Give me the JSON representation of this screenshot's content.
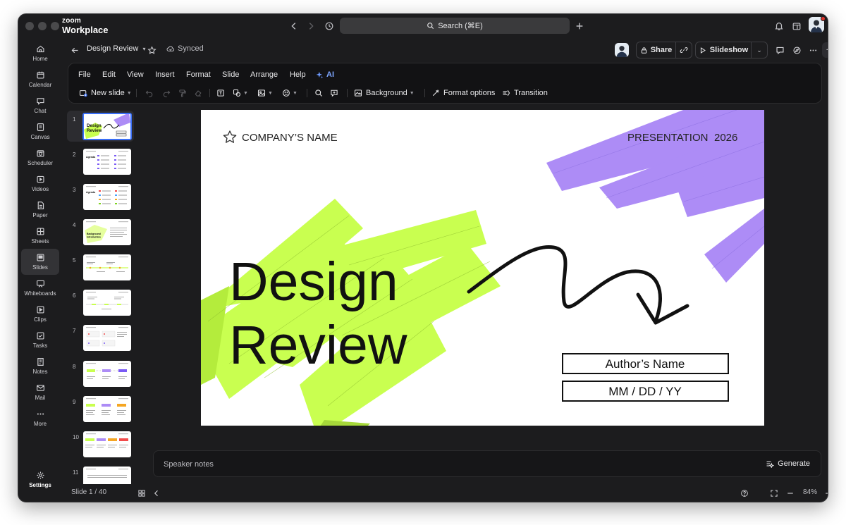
{
  "app": {
    "logo_line1": "zoom",
    "logo_line2": "Workplace",
    "search_placeholder": "Search (⌘E)"
  },
  "sidebar": {
    "items": [
      {
        "label": "Home",
        "icon": "home-icon"
      },
      {
        "label": "Calendar",
        "icon": "calendar-icon"
      },
      {
        "label": "Chat",
        "icon": "chat-icon"
      },
      {
        "label": "Canvas",
        "icon": "canvas-icon"
      },
      {
        "label": "Scheduler",
        "icon": "scheduler-icon"
      },
      {
        "label": "Videos",
        "icon": "videos-icon"
      },
      {
        "label": "Paper",
        "icon": "paper-icon"
      },
      {
        "label": "Sheets",
        "icon": "sheets-icon"
      },
      {
        "label": "Slides",
        "icon": "slides-icon",
        "active": true
      },
      {
        "label": "Whiteboards",
        "icon": "whiteboard-icon"
      },
      {
        "label": "Clips",
        "icon": "clips-icon"
      },
      {
        "label": "Tasks",
        "icon": "tasks-icon"
      },
      {
        "label": "Notes",
        "icon": "notes-icon"
      },
      {
        "label": "Mail",
        "icon": "mail-icon"
      },
      {
        "label": "More",
        "icon": "more-icon"
      }
    ],
    "settings_label": "Settings"
  },
  "header": {
    "doc_title": "Design Review",
    "sync_status": "Synced",
    "share_label": "Share",
    "slideshow_label": "Slideshow"
  },
  "menu": {
    "items": [
      "File",
      "Edit",
      "View",
      "Insert",
      "Format",
      "Slide",
      "Arrange",
      "Help"
    ],
    "ai_label": "AI"
  },
  "toolbar": {
    "new_slide_label": "New slide",
    "background_label": "Background",
    "format_options_label": "Format options",
    "transition_label": "Transition"
  },
  "thumbnails": {
    "numbers": [
      "1",
      "2",
      "3",
      "4",
      "5",
      "6",
      "7",
      "8",
      "9",
      "10",
      "11"
    ],
    "selected": 1,
    "t1_title_1": "Design",
    "t1_title_2": "Review",
    "t2_title": "Agenda",
    "t3_title": "Agenda",
    "t4_title_1": "Background",
    "t4_title_2": "introduction"
  },
  "slide": {
    "company_name": "COMPANY’S NAME",
    "presentation_label": "PRESENTATION",
    "year": "2026",
    "title_line1": "Design",
    "title_line2": "Review",
    "author_name": "Author’s Name",
    "date_placeholder": "MM / DD / YY",
    "accent_green": "#c9ff50",
    "accent_purple": "#ad8cf6"
  },
  "notes": {
    "placeholder": "Speaker notes",
    "generate_label": "Generate"
  },
  "status": {
    "slide_counter": "Slide  1 / 40",
    "zoom": "84%"
  }
}
